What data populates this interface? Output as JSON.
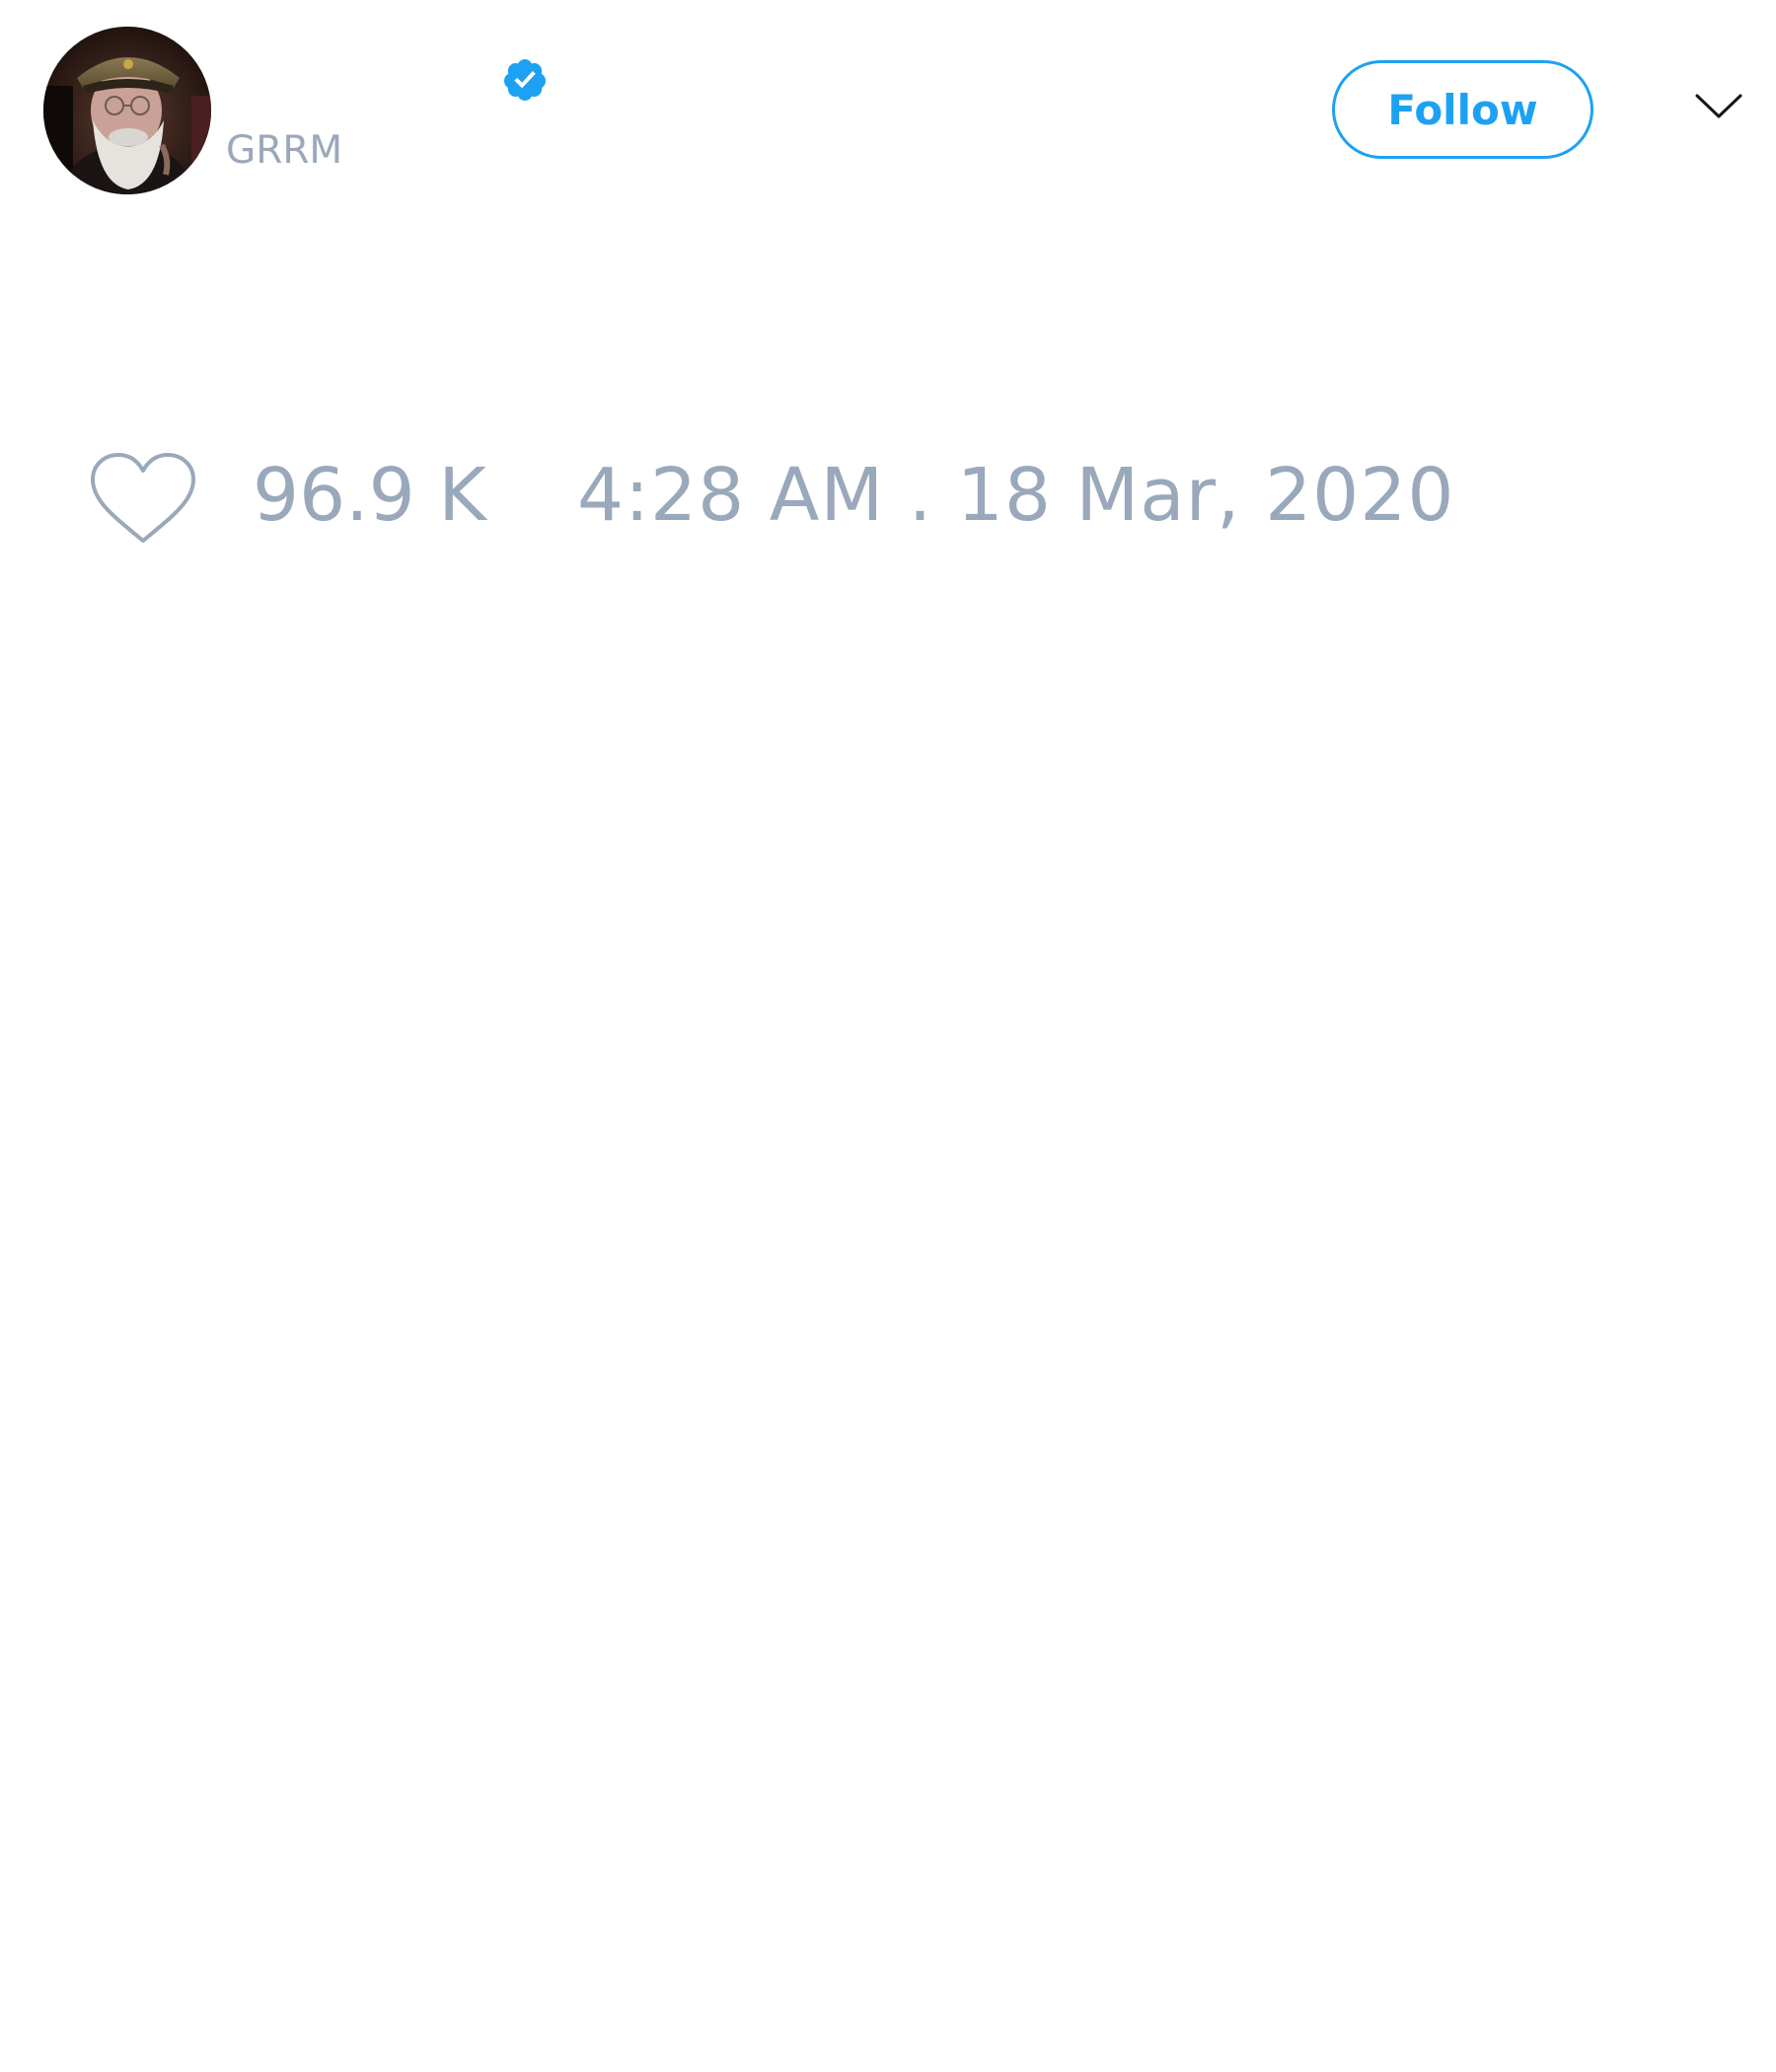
{
  "tweet": {
    "author": {
      "display_name": "",
      "handle": "GRRM",
      "avatar": "author-avatar",
      "verified": true,
      "verified_icon": "verified-badge-icon"
    },
    "header": {
      "follow_label": "Follow",
      "menu_icon": "chevron-down-icon"
    },
    "stats": {
      "like_icon": "heart-icon",
      "like_count": "96.9 K",
      "timestamp": "4:28 AM . 18 Mar, 2020"
    }
  },
  "colors": {
    "accent": "#1da1f2",
    "muted_text": "#9aa8bb",
    "background": "#ffffff"
  }
}
